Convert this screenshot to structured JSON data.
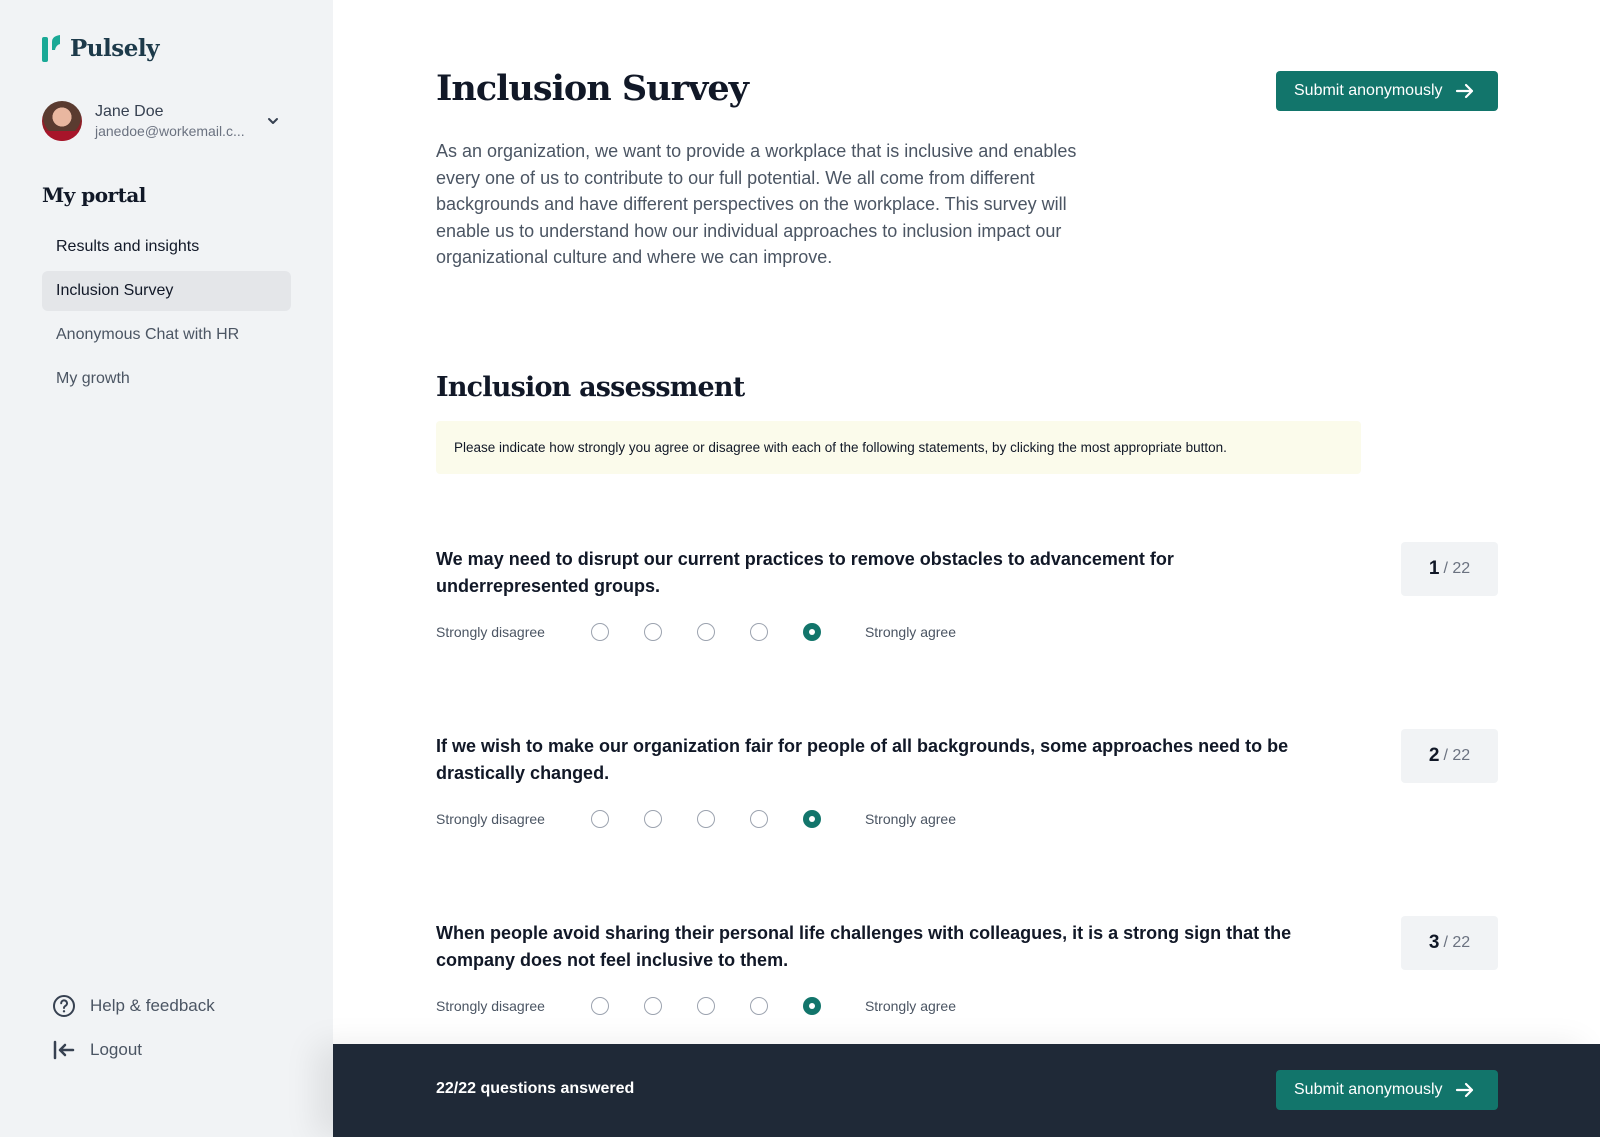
{
  "app": {
    "name": "Pulsely",
    "brand_color": "#12756b",
    "logo_color": "#1aa996"
  },
  "user": {
    "name": "Jane Doe",
    "email": "janedoe@workemail.c..."
  },
  "sidebar": {
    "section_title": "My portal",
    "items": [
      {
        "label": "Results and insights",
        "active": false
      },
      {
        "label": "Inclusion Survey",
        "active": true
      },
      {
        "label": "Anonymous Chat with HR",
        "active": false
      },
      {
        "label": "My growth",
        "active": false
      }
    ],
    "bottom": [
      {
        "label": "Help & feedback",
        "icon": "help-circle-icon"
      },
      {
        "label": "Logout",
        "icon": "logout-arrow-icon"
      }
    ]
  },
  "page": {
    "title": "Inclusion Survey",
    "submit_label": "Submit anonymously",
    "intro": "As an organization, we want to provide a workplace that is inclusive and enables every one of us to contribute to our full potential. We all come from different backgrounds and have different perspectives on the workplace. This survey will enable us to understand how our individual approaches to inclusion impact our organizational culture and where we can improve.",
    "section_title": "Inclusion assessment",
    "notice": "Please indicate how strongly you agree or disagree with each of the following statements, by clicking the most appropriate button."
  },
  "scale": {
    "low_label": "Strongly disagree",
    "high_label": "Strongly agree",
    "points": 5
  },
  "questions": [
    {
      "number": "1",
      "total": "/ 22",
      "text": "We may need to disrupt our current practices to remove obstacles to advancement for underrepresented groups.",
      "selected": 5
    },
    {
      "number": "2",
      "total": "/ 22",
      "text": "If we wish to make our organization fair for people of all backgrounds, some approaches need to be drastically changed.",
      "selected": 5
    },
    {
      "number": "3",
      "total": "/ 22",
      "text": "When people avoid sharing their personal life challenges with colleagues, it is a strong sign that the company does not feel inclusive to them.",
      "selected": 5
    }
  ],
  "footer": {
    "status": "22/22 questions answered",
    "submit_label": "Submit anonymously"
  }
}
